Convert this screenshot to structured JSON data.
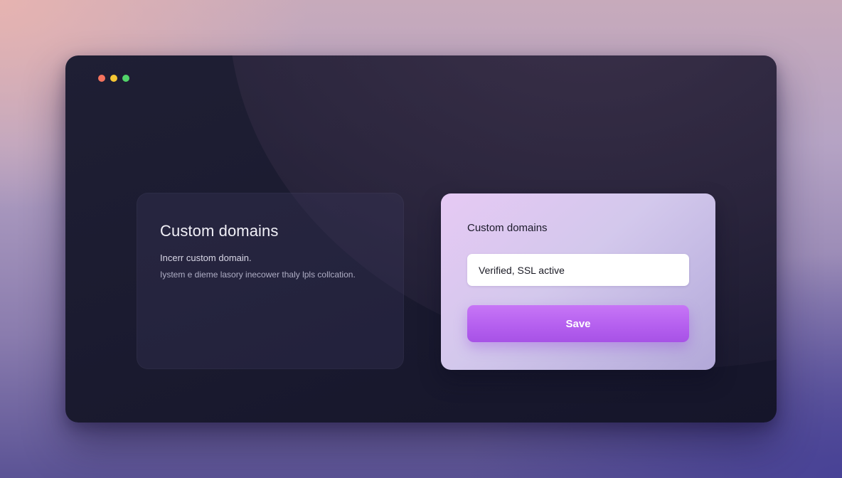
{
  "colors": {
    "close": "#f4735e",
    "minimize": "#f5c634",
    "maximize": "#52d46a",
    "accent": "#b560ef"
  },
  "info_card": {
    "title": "Custom domains",
    "line1": "Incerr custom domain.",
    "line2": "Iystem e dieme lasory inecower thaly lpls collcation."
  },
  "form_card": {
    "title": "Custom domains",
    "input_value": "Verified, SSL active",
    "save_label": "Save"
  }
}
